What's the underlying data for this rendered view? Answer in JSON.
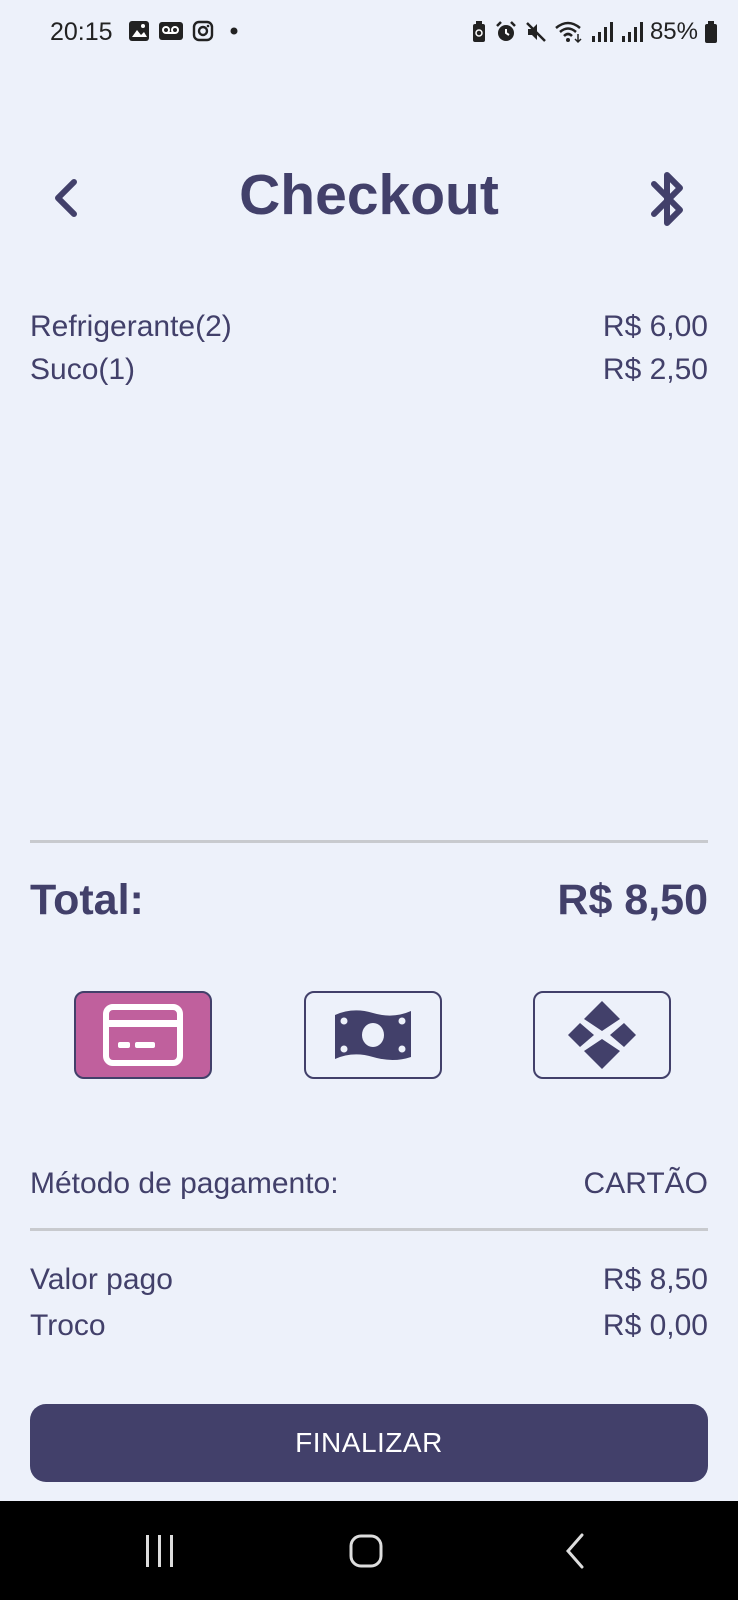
{
  "status_bar": {
    "time": "20:15",
    "battery_text": "85%",
    "left_icons": [
      "image-icon",
      "voicemail-icon",
      "instagram-icon",
      "dot-icon"
    ],
    "right_icons": [
      "battery-saver-icon",
      "alarm-icon",
      "mute-icon",
      "wifi-icon",
      "signal-icon",
      "signal-icon"
    ]
  },
  "header": {
    "title": "Checkout",
    "back_icon": "chevron-left-icon",
    "bluetooth_icon": "bluetooth-icon"
  },
  "items": [
    {
      "name": "Refrigerante(2)",
      "price": "R$ 6,00"
    },
    {
      "name": "Suco(1)",
      "price": "R$ 2,50"
    }
  ],
  "total": {
    "label": "Total:",
    "value": "R$ 8,50"
  },
  "payment_methods": [
    {
      "icon": "credit-card-icon",
      "selected": true
    },
    {
      "icon": "cash-icon",
      "selected": false
    },
    {
      "icon": "pix-icon",
      "selected": false
    }
  ],
  "payment_method": {
    "label": "Método de pagamento:",
    "value": "CARTÃO"
  },
  "summary": {
    "paid_label": "Valor pago",
    "paid_value": "R$ 8,50",
    "change_label": "Troco",
    "change_value": "R$ 0,00"
  },
  "finalize_label": "FINALIZAR",
  "colors": {
    "primary": "#42406a",
    "accent": "#c0609d",
    "background": "#edf1fa"
  },
  "nav_bar": {
    "icons": [
      "recent-apps-icon",
      "home-icon",
      "back-icon"
    ]
  }
}
